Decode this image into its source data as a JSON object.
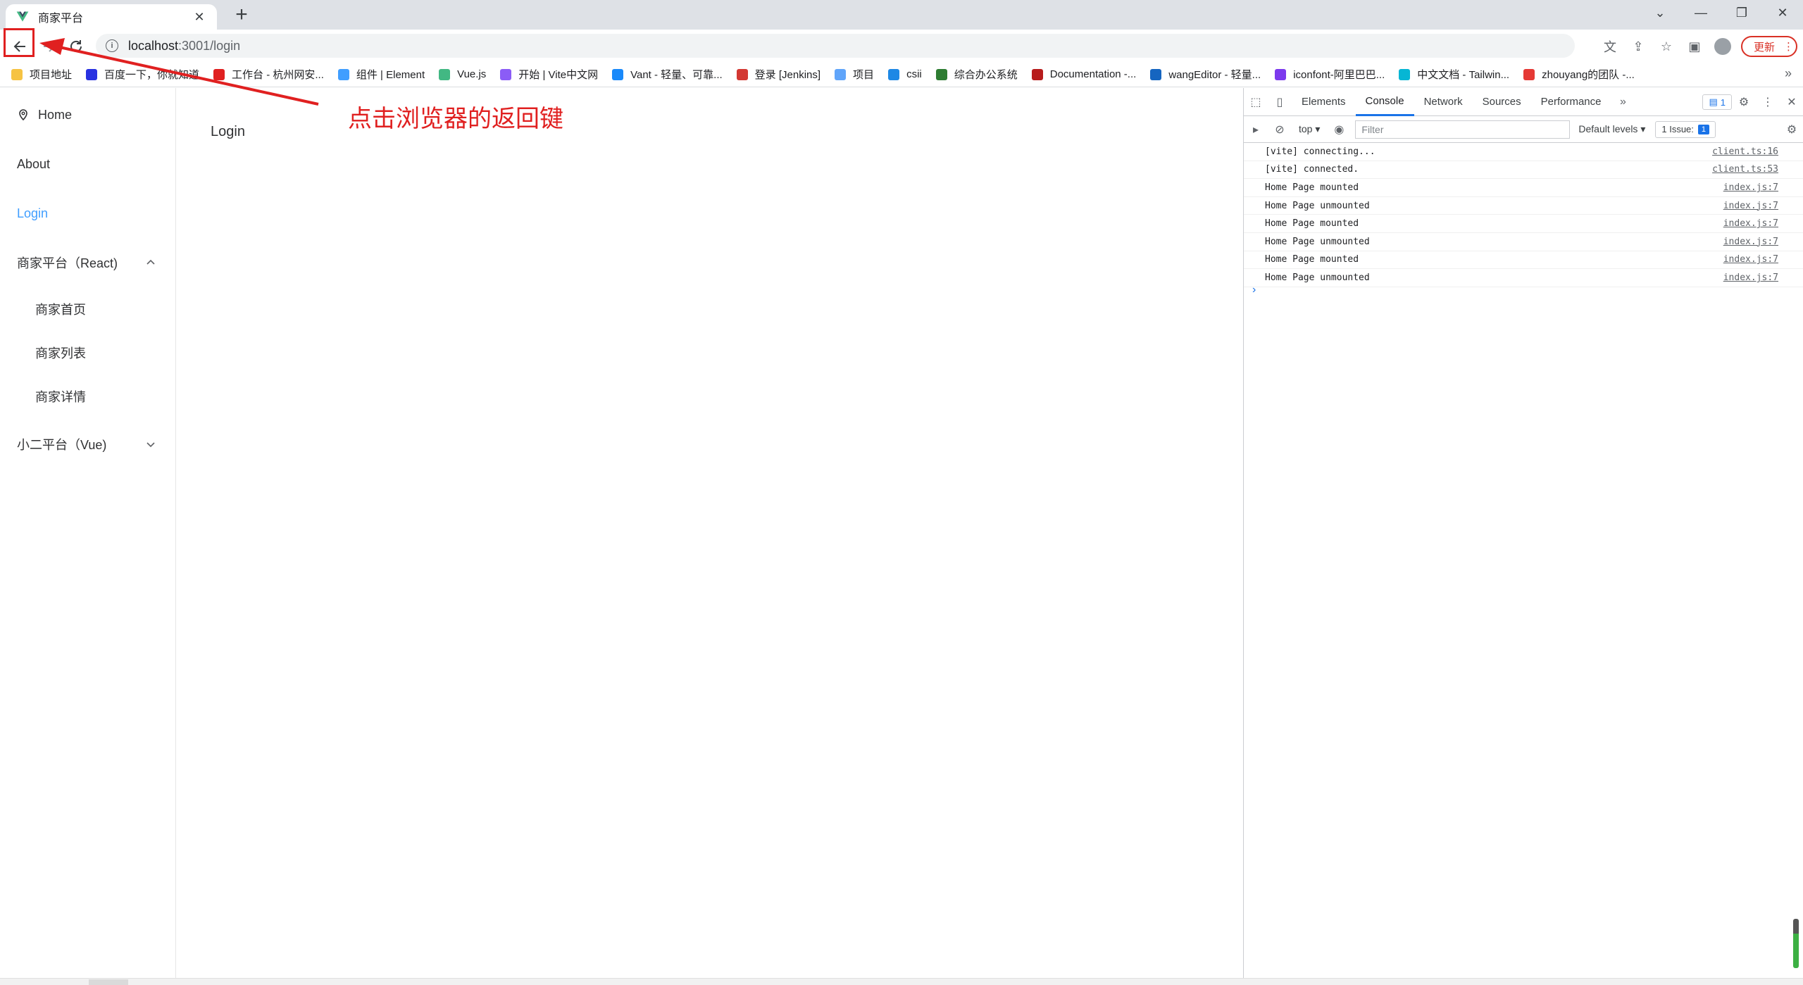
{
  "browser": {
    "tab_title": "商家平台",
    "url_host": "localhost",
    "url_path": ":3001/login",
    "update_label": "更新"
  },
  "bookmarks": [
    {
      "label": "项目地址",
      "icon": "folder-icon",
      "color": "#f6c343"
    },
    {
      "label": "百度一下，你就知道",
      "icon": "baidu-icon",
      "color": "#2932e1"
    },
    {
      "label": "工作台 - 杭州网安...",
      "icon": "g-icon",
      "color": "#e02020"
    },
    {
      "label": "组件 | Element",
      "icon": "element-icon",
      "color": "#409eff"
    },
    {
      "label": "Vue.js",
      "icon": "vue-icon",
      "color": "#42b883"
    },
    {
      "label": "开始 | Vite中文网",
      "icon": "vite-icon",
      "color": "#8b5cf6"
    },
    {
      "label": "Vant - 轻量、可靠...",
      "icon": "vant-icon",
      "color": "#1989fa"
    },
    {
      "label": "登录 [Jenkins]",
      "icon": "jenkins-icon",
      "color": "#d33833"
    },
    {
      "label": "项目",
      "icon": "project-icon",
      "color": "#60a5fa"
    },
    {
      "label": "csii",
      "icon": "csii-icon",
      "color": "#1e88e5"
    },
    {
      "label": "综合办公系统",
      "icon": "office-icon",
      "color": "#2e7d32"
    },
    {
      "label": "Documentation -...",
      "icon": "doc-icon",
      "color": "#b71c1c"
    },
    {
      "label": "wangEditor - 轻量...",
      "icon": "wang-icon",
      "color": "#1565c0"
    },
    {
      "label": "iconfont-阿里巴巴...",
      "icon": "iconfont-icon",
      "color": "#7c3aed"
    },
    {
      "label": "中文文档 - Tailwin...",
      "icon": "tailwind-icon",
      "color": "#06b6d4"
    },
    {
      "label": "zhouyang的团队 -...",
      "icon": "team-icon",
      "color": "#e53935"
    }
  ],
  "sidebar": {
    "home": "Home",
    "about": "About",
    "login": "Login",
    "react_group": "商家平台（React)",
    "react_items": [
      "商家首页",
      "商家列表",
      "商家详情"
    ],
    "vue_group": "小二平台（Vue)"
  },
  "main": {
    "content": "Login"
  },
  "annotation": "点击浏览器的返回键",
  "devtools": {
    "tabs": [
      "Elements",
      "Console",
      "Network",
      "Sources",
      "Performance"
    ],
    "active_tab": "Console",
    "message_badge": "1",
    "context": "top",
    "filter_placeholder": "Filter",
    "levels": "Default levels",
    "issues_label": "1 Issue:",
    "issues_count": "1",
    "logs": [
      {
        "text": "[vite] connecting...",
        "source": "client.ts:16"
      },
      {
        "text": "[vite] connected.",
        "source": "client.ts:53"
      },
      {
        "text": "Home Page mounted",
        "source": "index.js:7"
      },
      {
        "text": "Home Page unmounted",
        "source": "index.js:7"
      },
      {
        "text": "Home Page mounted",
        "source": "index.js:7"
      },
      {
        "text": "Home Page unmounted",
        "source": "index.js:7"
      },
      {
        "text": "Home Page mounted",
        "source": "index.js:7"
      },
      {
        "text": "Home Page unmounted",
        "source": "index.js:7"
      }
    ]
  },
  "colors": {
    "accent": "#409eff",
    "annotation": "#e02020",
    "devtools_blue": "#1a73e8"
  }
}
